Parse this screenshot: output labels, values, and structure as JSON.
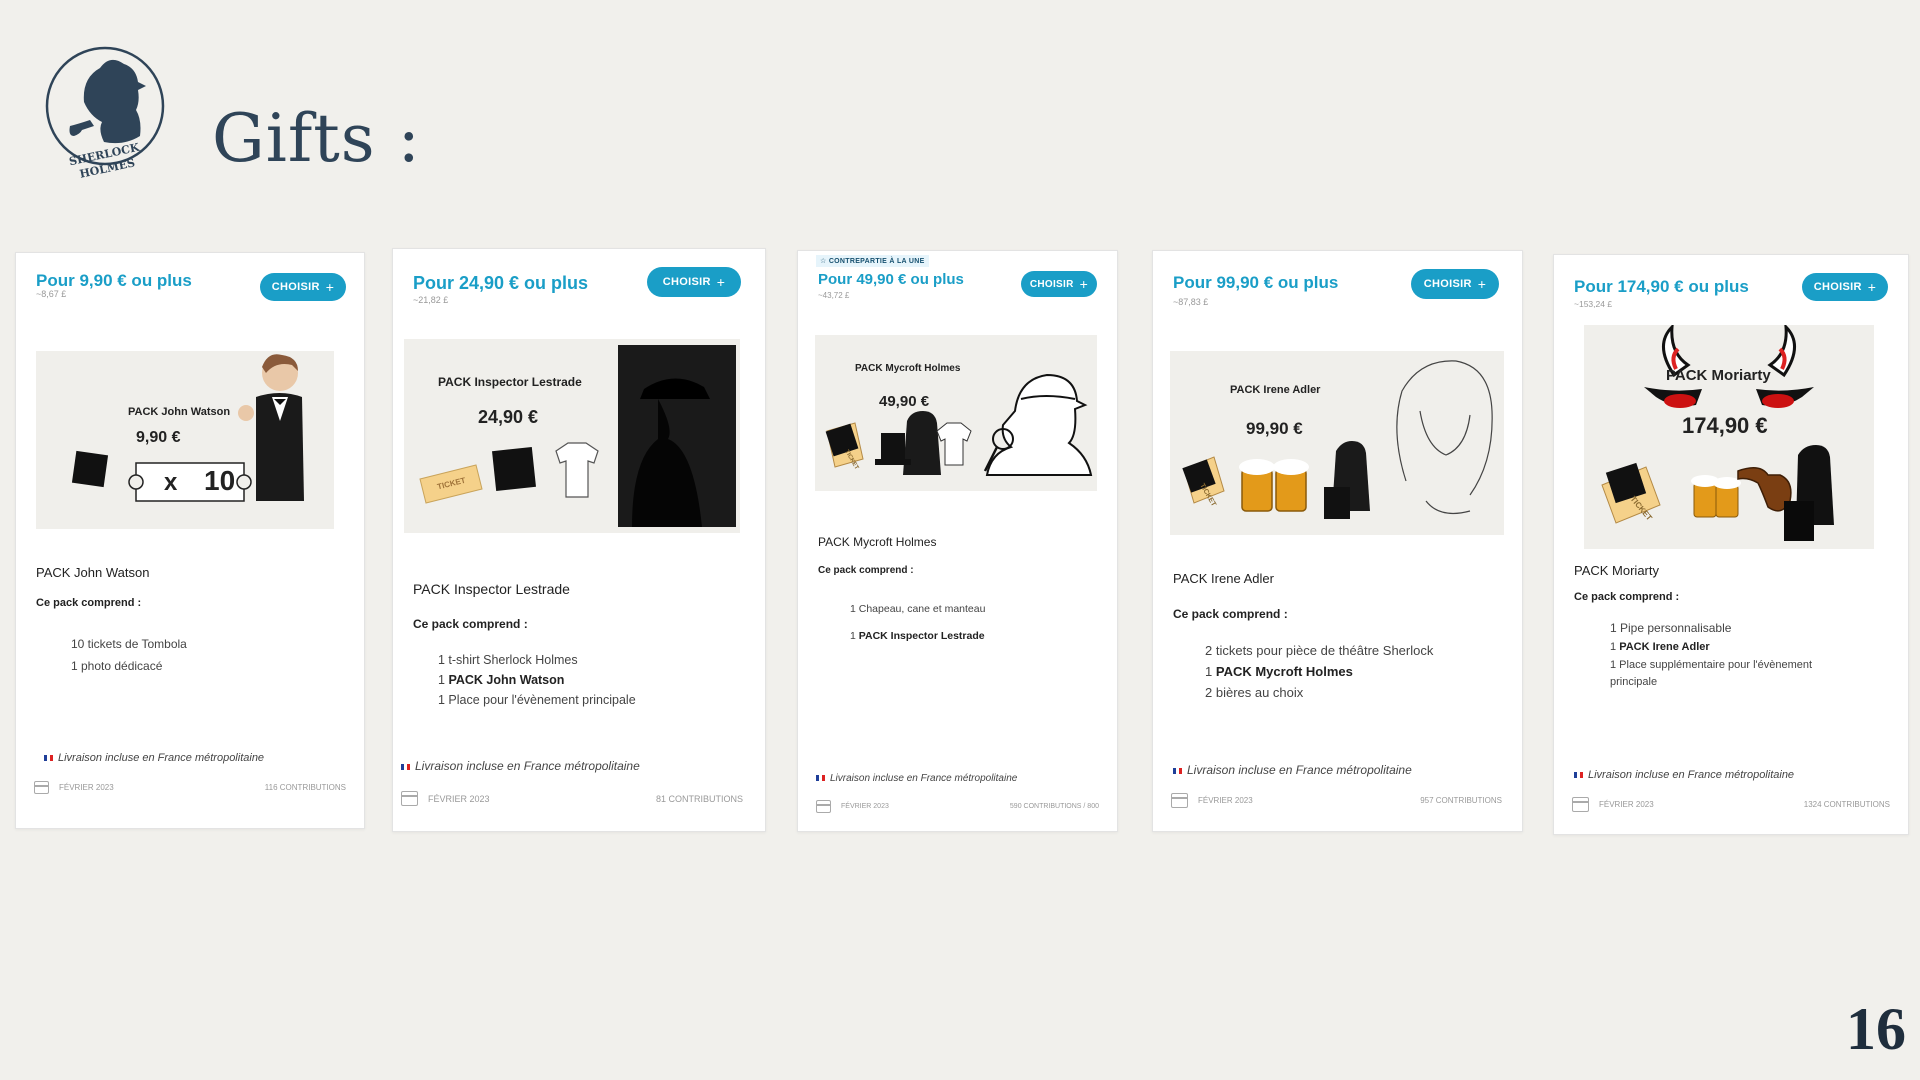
{
  "slide": {
    "title": "Gifts :",
    "page_number": "16",
    "logo_text_top": "SHERLOCK",
    "logo_text_bottom": "HOLMES"
  },
  "common": {
    "choose_label": "CHOISIR",
    "delivery": "Livraison incluse en France métropolitaine",
    "includes": "Ce pack comprend :",
    "date": "FÉVRIER 2023"
  },
  "cards": [
    {
      "price": "Pour 9,90 €  ou plus",
      "approx": "~8,67 £",
      "image_name": "PACK John Watson",
      "image_price": "9,90 €",
      "ticket_count": "10",
      "ticket_x": "x",
      "pack_name": "PACK John Watson",
      "items": [
        "10 tickets de Tombola",
        "1 photo dédicacé"
      ],
      "contributions": "116 CONTRIBUTIONS"
    },
    {
      "price": "Pour 24,90 € ou plus",
      "approx": "~21,82 £",
      "image_name": "PACK Inspector Lestrade",
      "image_price": "24,90 €",
      "ticket_label": "TICKET",
      "pack_name": "PACK Inspector Lestrade",
      "items": [
        "1 t-shirt Sherlock Holmes",
        "PACK John Watson",
        "1 Place pour l'évènement principale"
      ],
      "item_prefix_2": "1",
      "contributions": "81 CONTRIBUTIONS"
    },
    {
      "highlight": "CONTREPARTIE À LA UNE",
      "price": "Pour 49,90 € ou plus",
      "approx": "~43,72 £",
      "image_name": "PACK Mycroft Holmes",
      "image_price": "49,90 €",
      "ticket_label": "TICKET",
      "pack_name": "PACK Mycroft Holmes",
      "items": [
        "1 Chapeau, cane et manteau",
        "PACK Inspector Lestrade"
      ],
      "item_prefix_2": "1",
      "contributions": "590 CONTRIBUTIONS / 800"
    },
    {
      "price": "Pour 99,90 € ou plus",
      "approx": "~87,83 £",
      "image_name": "PACK Irene Adler",
      "image_price": "99,90 €",
      "ticket_label": "TICKET",
      "pack_name": "PACK Irene Adler",
      "items": [
        "2 tickets pour pièce de théâtre Sherlock",
        "PACK Mycroft Holmes",
        "2 bières au choix"
      ],
      "item_prefix_2": "1",
      "contributions": "957 CONTRIBUTIONS"
    },
    {
      "price": "Pour 174,90 € ou plus",
      "approx": "~153,24 £",
      "image_name": "PACK Moriarty",
      "image_price": "174,90 €",
      "ticket_label": "TICKET",
      "pack_name": "PACK Moriarty",
      "items": [
        "1 Pipe personnalisable",
        "PACK Irene Adler",
        "1 Place supplémentaire pour l'évènement principale"
      ],
      "item_prefix_2": "1",
      "contributions": "1324 CONTRIBUTIONS"
    }
  ]
}
